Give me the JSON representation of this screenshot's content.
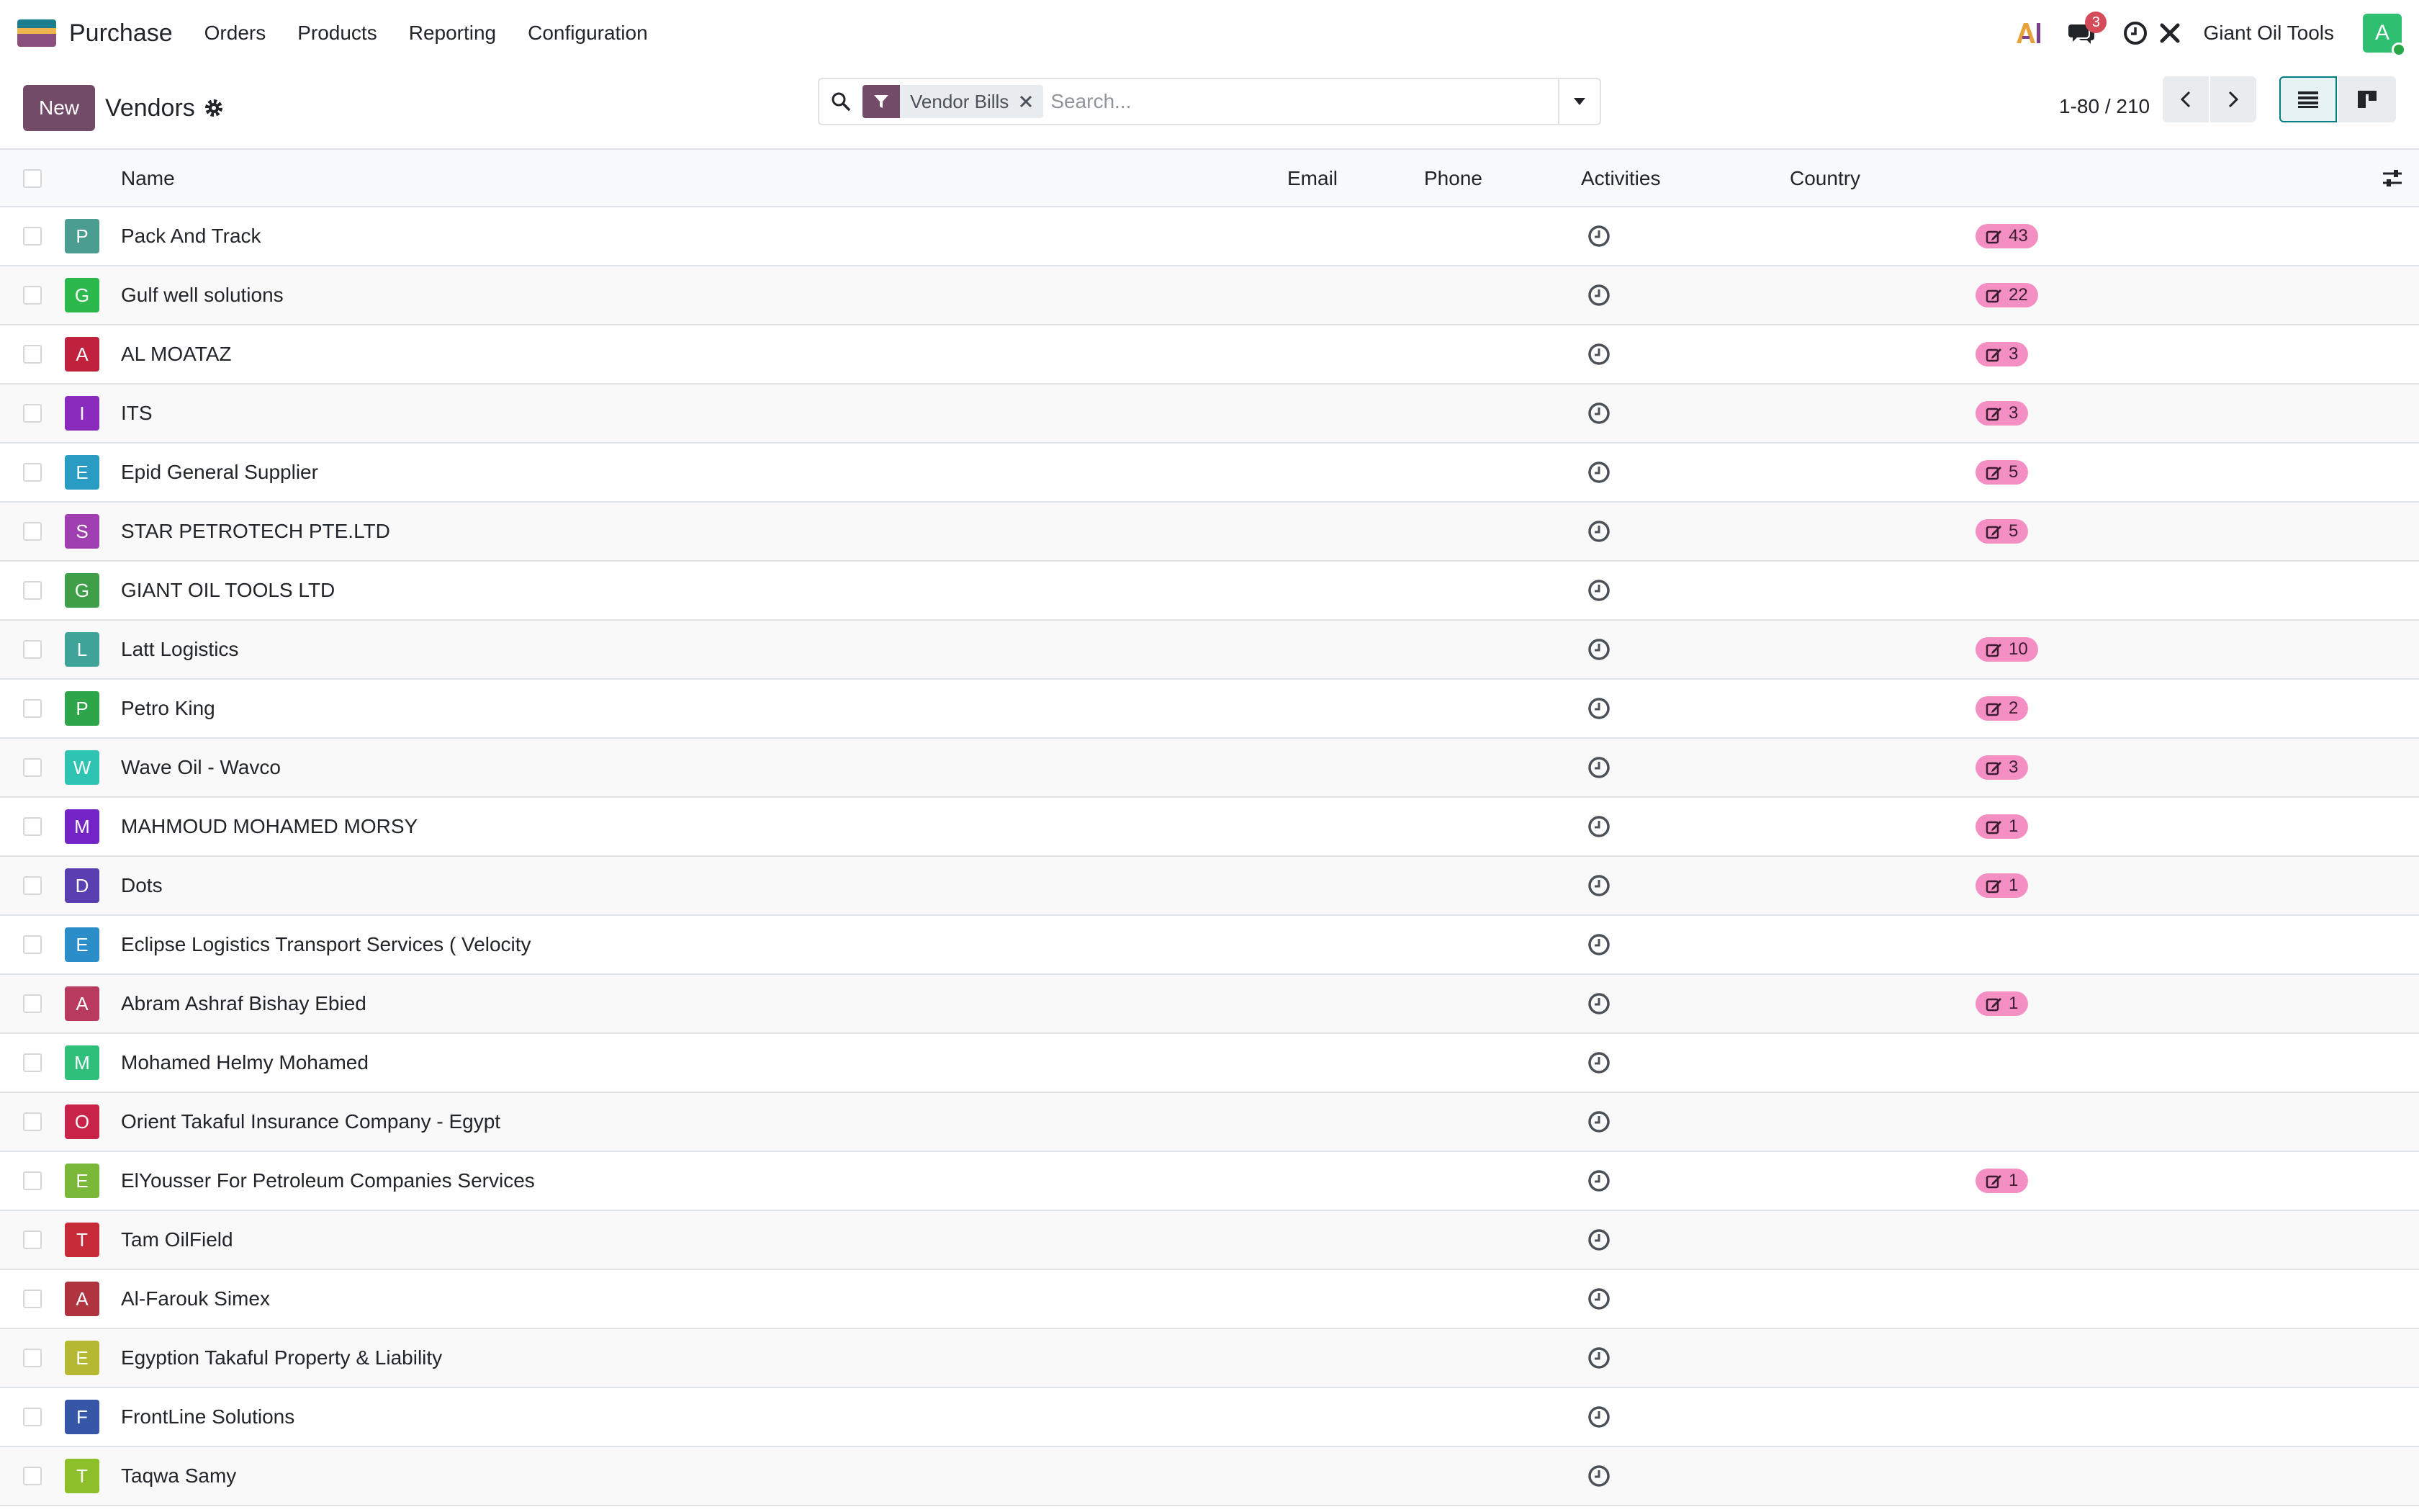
{
  "navbar": {
    "app_name": "Purchase",
    "menu": [
      "Orders",
      "Products",
      "Reporting",
      "Configuration"
    ],
    "notifications_count": "3",
    "company": "Giant Oil Tools",
    "user_initial": "A"
  },
  "control_panel": {
    "new_label": "New",
    "title": "Vendors",
    "facet_label": "Vendor Bills",
    "search_placeholder": "Search...",
    "pager_text": "1-80 / 210"
  },
  "table": {
    "columns": {
      "name": "Name",
      "email": "Email",
      "phone": "Phone",
      "activities": "Activities",
      "country": "Country"
    },
    "rows": [
      {
        "initial": "P",
        "color": "#4a9d8f",
        "name": "Pack And Track",
        "bills": "43"
      },
      {
        "initial": "G",
        "color": "#2db84d",
        "name": "Gulf well solutions",
        "bills": "22"
      },
      {
        "initial": "A",
        "color": "#c0213d",
        "name": "AL MOATAZ",
        "bills": "3"
      },
      {
        "initial": "I",
        "color": "#8a2bbd",
        "name": "ITS",
        "bills": "3"
      },
      {
        "initial": "E",
        "color": "#2a9bc2",
        "name": "Epid General Supplier",
        "bills": "5"
      },
      {
        "initial": "S",
        "color": "#a03fb0",
        "name": "STAR PETROTECH PTE.LTD",
        "bills": "5"
      },
      {
        "initial": "G",
        "color": "#3f9e48",
        "name": "GIANT OIL TOOLS LTD",
        "bills": ""
      },
      {
        "initial": "L",
        "color": "#3fa39a",
        "name": "Latt Logistics",
        "bills": "10"
      },
      {
        "initial": "P",
        "color": "#2fa54a",
        "name": "Petro King",
        "bills": "2"
      },
      {
        "initial": "W",
        "color": "#2ec3b3",
        "name": "Wave Oil - Wavco",
        "bills": "3"
      },
      {
        "initial": "M",
        "color": "#7424c4",
        "name": "MAHMOUD MOHAMED MORSY",
        "bills": "1"
      },
      {
        "initial": "D",
        "color": "#5a3fb0",
        "name": "Dots",
        "bills": "1"
      },
      {
        "initial": "E",
        "color": "#2b8ec9",
        "name": "Eclipse Logistics Transport Services ( Velocity",
        "bills": ""
      },
      {
        "initial": "A",
        "color": "#b83a5e",
        "name": "Abram Ashraf Bishay Ebied",
        "bills": "1"
      },
      {
        "initial": "M",
        "color": "#2fbf7a",
        "name": "Mohamed Helmy Mohamed",
        "bills": ""
      },
      {
        "initial": "O",
        "color": "#c8244a",
        "name": "Orient Takaful Insurance Company - Egypt",
        "bills": ""
      },
      {
        "initial": "E",
        "color": "#7ab83a",
        "name": "ElYousser For Petroleum Companies Services",
        "bills": "1"
      },
      {
        "initial": "T",
        "color": "#c72b3a",
        "name": "Tam OilField",
        "bills": ""
      },
      {
        "initial": "A",
        "color": "#b0343f",
        "name": "Al-Farouk Simex",
        "bills": ""
      },
      {
        "initial": "E",
        "color": "#b4b832",
        "name": "Egyption Takaful Property & Liability",
        "bills": ""
      },
      {
        "initial": "F",
        "color": "#3657a8",
        "name": "FrontLine Solutions",
        "bills": ""
      },
      {
        "initial": "T",
        "color": "#8cbf2a",
        "name": "Taqwa Samy",
        "bills": ""
      }
    ]
  },
  "colors": {
    "brand": "#714b67",
    "accent": "#017e84",
    "pill": "#f48fc4"
  }
}
